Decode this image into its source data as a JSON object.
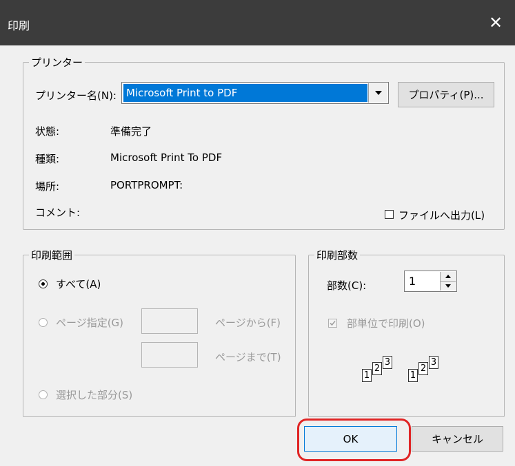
{
  "window": {
    "title": "印刷",
    "close_glyph": "✕"
  },
  "printer": {
    "group_label": "プリンター",
    "name_label": "プリンター名(N):",
    "name_value": "Microsoft Print to PDF",
    "properties_button": "プロパティ(P)...",
    "status_label": "状態:",
    "status_value": "準備完了",
    "type_label": "種類:",
    "type_value": "Microsoft Print To PDF",
    "location_label": "場所:",
    "location_value": "PORTPROMPT:",
    "comment_label": "コメント:",
    "print_to_file_label": "ファイルへ出力(L)"
  },
  "range": {
    "group_label": "印刷範囲",
    "all_label": "すべて(A)",
    "pages_label": "ページ指定(G)",
    "from_label": "ページから(F)",
    "to_label": "ページまで(T)",
    "selection_label": "選択した部分(S)"
  },
  "copies": {
    "group_label": "印刷部数",
    "count_label": "部数(C):",
    "count_value": "1",
    "collate_label": "部単位で印刷(O)",
    "collate_pages": [
      "1",
      "2",
      "3"
    ]
  },
  "buttons": {
    "ok": "OK",
    "cancel": "キャンセル"
  }
}
